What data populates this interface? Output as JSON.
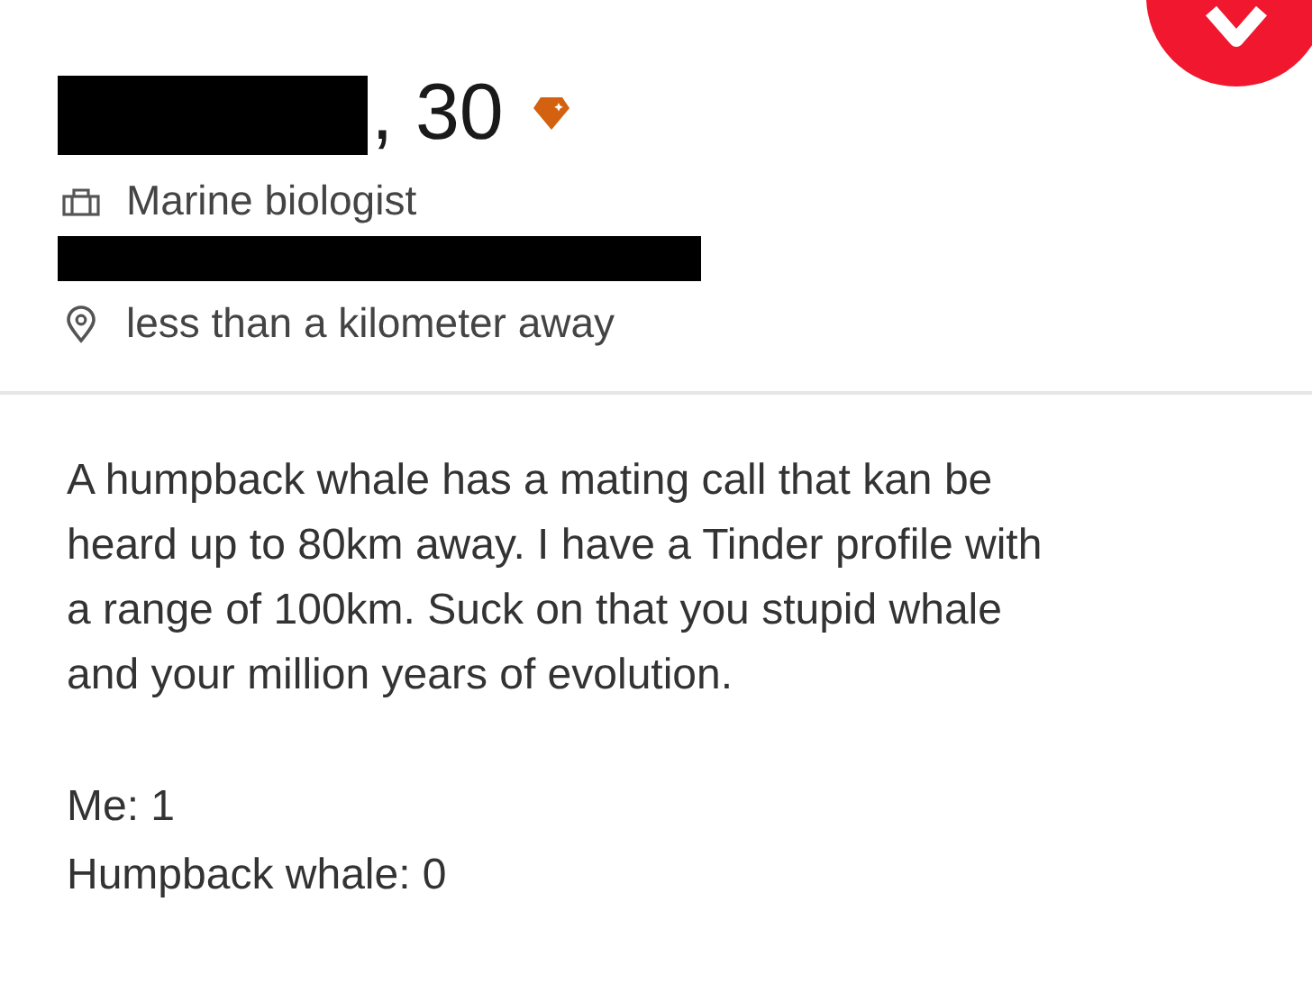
{
  "profile": {
    "age": ", 30",
    "job": "Marine biologist",
    "distance": "less than a kilometer away"
  },
  "bio": {
    "lines": [
      "A humpback whale has a mating call that kan be",
      "heard up to 80km away. I have a Tinder profile with",
      "a range of 100km. Suck on that you stupid whale",
      "and your million years of evolution."
    ]
  },
  "score": [
    "Me: 1",
    "Humpback whale: 0"
  ]
}
